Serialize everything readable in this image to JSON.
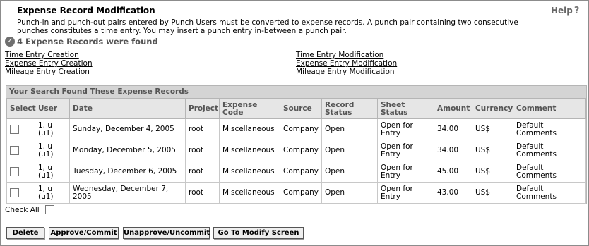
{
  "header": {
    "title": "Expense Record Modification",
    "help_label": "Help",
    "help_glyph": "?",
    "description": "Punch-in and punch-out pairs entered by Punch Users must be converted to expense records. A punch pair containing two consecutive punches constitutes a time entry. You may insert a punch entry in-between a punch pair.",
    "found_message": "4 Expense Records were found"
  },
  "links_left": [
    "Time Entry Creation",
    "Expense Entry Creation",
    "Mileage Entry Creation"
  ],
  "links_right": [
    "Time Entry Modification",
    "Expense Entry Modification",
    "Mileage Entry Modification"
  ],
  "table": {
    "caption": "Your Search Found These Expense Records",
    "columns": [
      "Select",
      "User",
      "Date",
      "Project",
      "Expense Code",
      "Source",
      "Record Status",
      "Sheet Status",
      "Amount",
      "Currency",
      "Comment"
    ],
    "rows": [
      {
        "user": "1, u (u1)",
        "date": "Sunday, December 4, 2005",
        "project": "root",
        "expense_code": "Miscellaneous",
        "source": "Company",
        "record_status": "Open",
        "sheet_status": "Open for Entry",
        "amount": "34.00",
        "currency": "US$",
        "comment": "Default Comments"
      },
      {
        "user": "1, u (u1)",
        "date": "Monday, December 5, 2005",
        "project": "root",
        "expense_code": "Miscellaneous",
        "source": "Company",
        "record_status": "Open",
        "sheet_status": "Open for Entry",
        "amount": "34.00",
        "currency": "US$",
        "comment": "Default Comments"
      },
      {
        "user": "1, u (u1)",
        "date": "Tuesday, December 6, 2005",
        "project": "root",
        "expense_code": "Miscellaneous",
        "source": "Company",
        "record_status": "Open",
        "sheet_status": "Open for Entry",
        "amount": "45.00",
        "currency": "US$",
        "comment": "Default Comments"
      },
      {
        "user": "1, u (u1)",
        "date": "Wednesday, December 7, 2005",
        "project": "root",
        "expense_code": "Miscellaneous",
        "source": "Company",
        "record_status": "Open",
        "sheet_status": "Open for Entry",
        "amount": "43.00",
        "currency": "US$",
        "comment": "Default Comments"
      }
    ]
  },
  "check_all_label": "Check All",
  "buttons": {
    "delete": "Delete",
    "approve": "Approve/Commit",
    "unapprove": "Unapprove/Uncommit",
    "modify": "Go To Modify Screen"
  },
  "colors": {
    "caption_bg": "#d4d4d4",
    "header_bg": "#e6e6e6",
    "border": "#b5b5b5"
  },
  "icons": {
    "found": "check-circle-icon",
    "help": "help-question-icon"
  }
}
